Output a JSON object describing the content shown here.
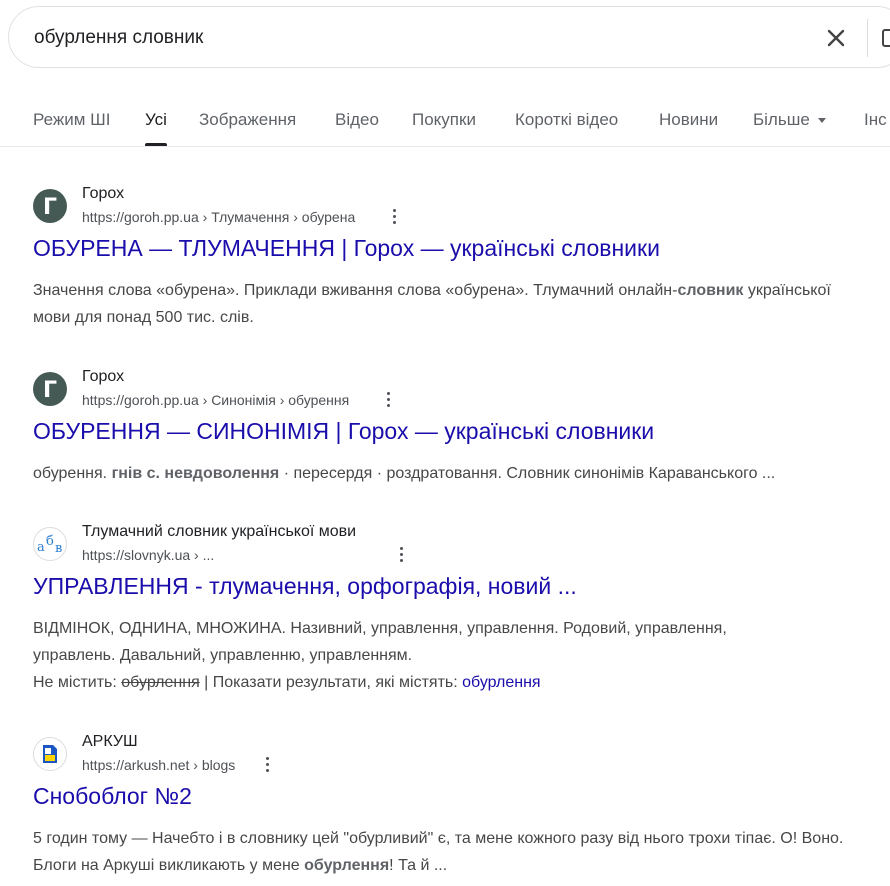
{
  "search": {
    "query": "обурлення словник"
  },
  "tabs": [
    "Режим ШІ",
    "Усі",
    "Зображення",
    "Відео",
    "Покупки",
    "Короткі відео",
    "Новини",
    "Більше",
    "Інс"
  ],
  "results": [
    {
      "site": "Горох",
      "url": "https://goroh.pp.ua › Тлумачення › обурена",
      "title": "ОБУРЕНА — ТЛУМАЧЕННЯ | Горох — українські словники",
      "snippet": [
        {
          "t": "Значення слова «обурена». Приклади вживання слова «обурена». Тлумачний онлайн-",
          "b": false
        },
        {
          "t": "словник",
          "b": true
        },
        {
          "t": " української мови для понад 500 тис. слів.",
          "b": false
        }
      ]
    },
    {
      "site": "Горох",
      "url": "https://goroh.pp.ua › Синонімія › обурення",
      "title": "ОБУРЕННЯ — СИНОНІМІЯ | Горох — українські словники",
      "snippet": [
        {
          "t": "обурення. ",
          "b": false
        },
        {
          "t": "гнів с. невдоволення",
          "b": true
        },
        {
          "t": " · пересердя · роздратовання. Словник синонімів Караванського ...",
          "b": false
        }
      ]
    },
    {
      "site": "Тлумачний словник української мови",
      "url": "https://slovnyk.ua › ...",
      "title": "УПРАВЛЕННЯ - тлумачення, орфографія, новий ...",
      "snippet": [
        {
          "t": "ВІДМІНОК, ОДНИНА, МНОЖИНА. Називний, управлення, управлення. Родовий, управлення, управлень. Давальний, управленню, управленням.",
          "b": false
        }
      ],
      "missing": {
        "prefix": "Не містить: ",
        "struck": "обурлення",
        "middle": " | Показати результати, які містять: ",
        "link": "обурлення"
      }
    },
    {
      "site": "АРКУШ",
      "url": "https://arkush.net › blogs",
      "title": "Снобоблог №2",
      "snippet": [
        {
          "t": "5 годин тому — Начебто і в словнику цей \"обурливий\" є, та мене кожного разу від нього трохи тіпає. О! Воно. Блоги на Аркуші викликають у мене ",
          "b": false
        },
        {
          "t": "обурлення",
          "b": true
        },
        {
          "t": "! Та й ...",
          "b": false
        }
      ]
    }
  ],
  "favicons": {
    "goroh": {
      "letter": "Г",
      "bg": "#455a55"
    },
    "slovnyk": {
      "text_a": "а",
      "text_b": "б",
      "text_c": "в"
    },
    "arkush": {
      "blue": "#1a56c4",
      "yellow": "#ffd500"
    }
  },
  "colors": {
    "link": "#1a0dab",
    "text": "#202124",
    "muted": "#4d5156"
  }
}
